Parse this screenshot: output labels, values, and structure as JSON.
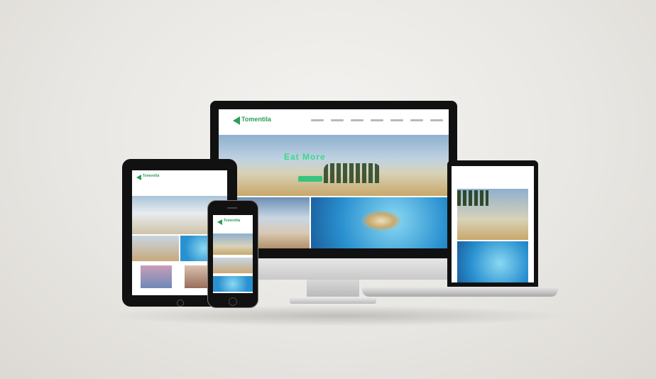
{
  "scene": {
    "description_free": true
  },
  "desktop_site": {
    "logo_text": "Tomentila",
    "hero_title": "Eat More"
  },
  "tablet_site": {
    "logo_text": "Tomentila"
  },
  "phone_site": {
    "logo_text": "Tomentila"
  },
  "colors": {
    "brand_green": "#2c9e58",
    "hero_accent": "#3bd98a",
    "device_black": "#111111",
    "background": "#ebe9e5"
  },
  "icons": [
    "logo-arrow-icon",
    "home-button-icon"
  ]
}
